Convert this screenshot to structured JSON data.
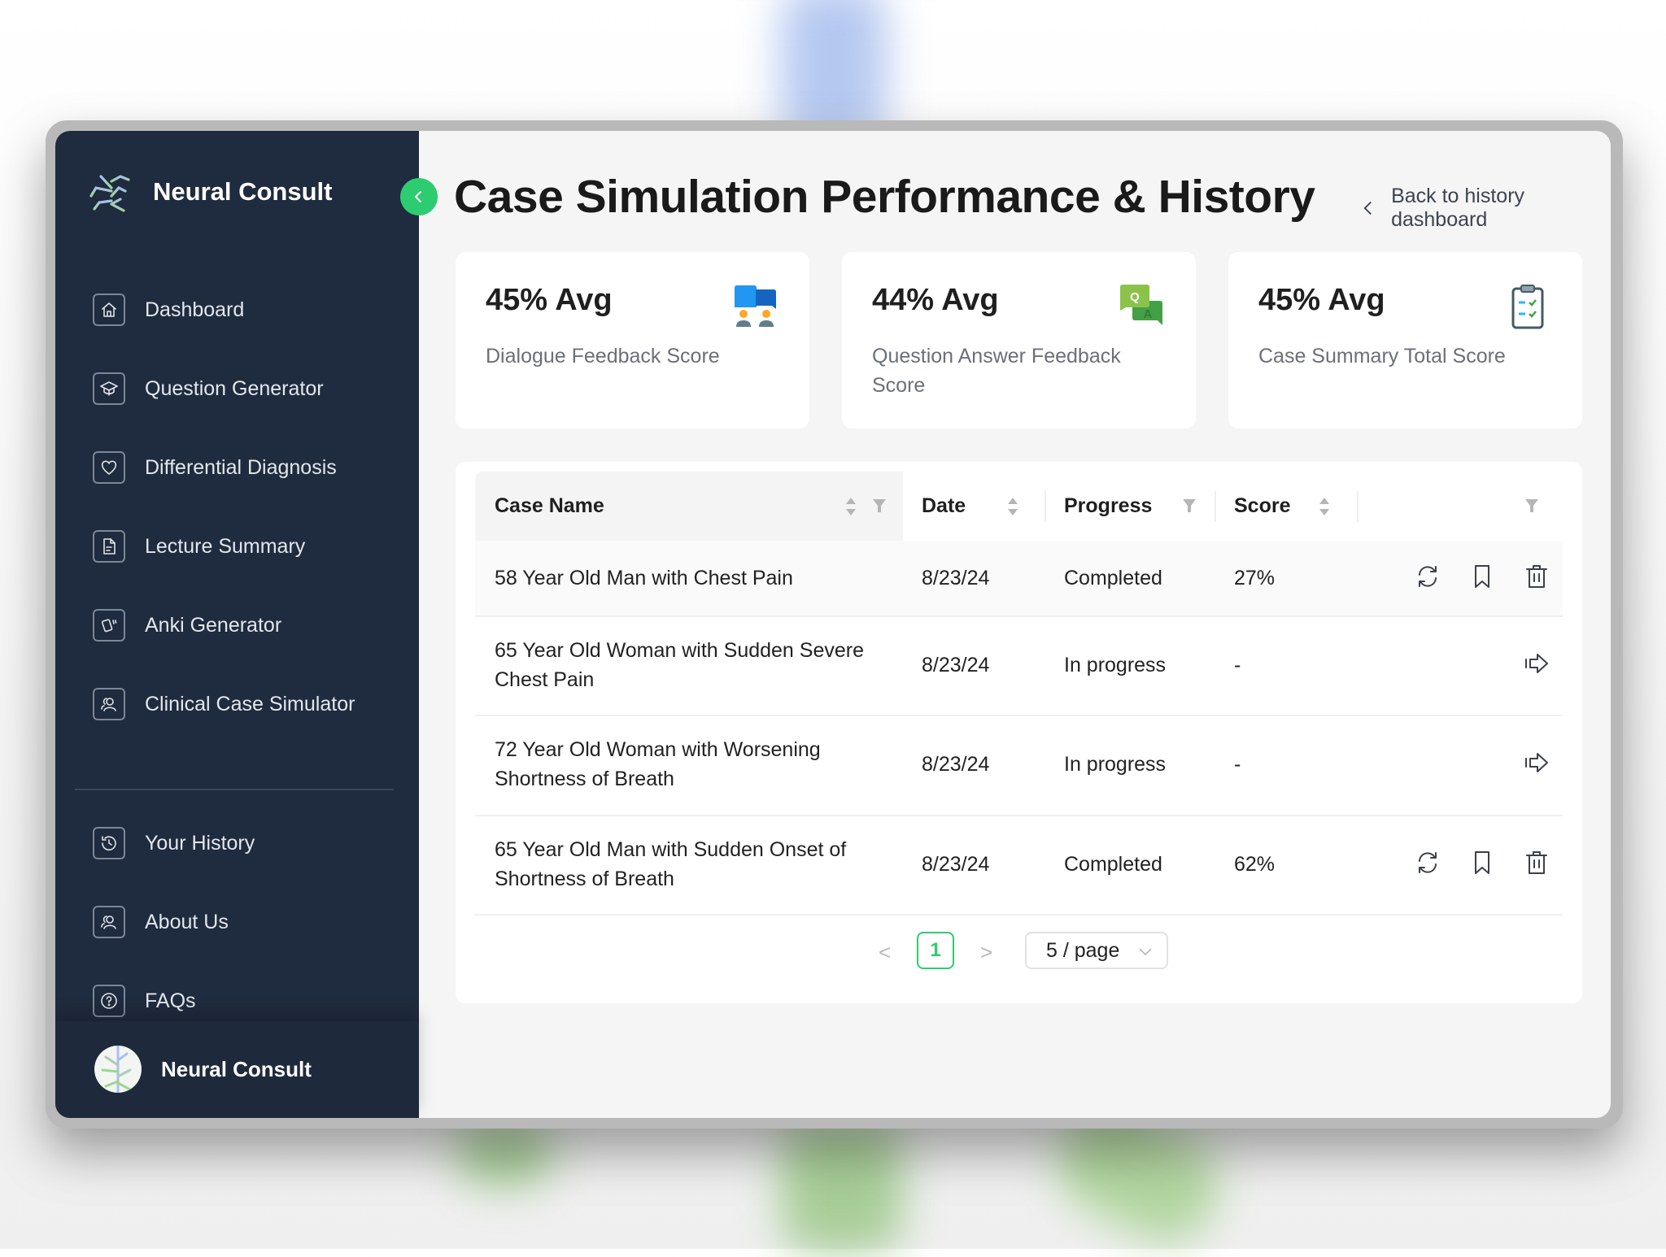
{
  "app": {
    "name": "Neural Consult"
  },
  "sidebar": {
    "brand": "Neural Consult",
    "items": [
      {
        "label": "Dashboard",
        "icon": "home-icon"
      },
      {
        "label": "Question Generator",
        "icon": "graduation-cap-icon"
      },
      {
        "label": "Differential Diagnosis",
        "icon": "heart-icon"
      },
      {
        "label": "Lecture Summary",
        "icon": "document-icon"
      },
      {
        "label": "Anki Generator",
        "icon": "cards-icon"
      },
      {
        "label": "Clinical Case Simulator",
        "icon": "users-icon"
      }
    ],
    "secondary_items": [
      {
        "label": "Your History",
        "icon": "history-icon"
      },
      {
        "label": "About Us",
        "icon": "users-icon"
      },
      {
        "label": "FAQs",
        "icon": "question-circle-icon"
      }
    ],
    "profile_name": "Neural Consult"
  },
  "header": {
    "title": "Case Simulation Performance & History",
    "back_link": "Back to history dashboard"
  },
  "stats": [
    {
      "value": "45% Avg",
      "label": "Dialogue Feedback Score",
      "icon": "dialogue-icon"
    },
    {
      "value": "44% Avg",
      "label": "Question Answer Feedback Score",
      "icon": "qa-icon",
      "icon_q": "Q",
      "icon_a": "A"
    },
    {
      "value": "45% Avg",
      "label": "Case Summary Total Score",
      "icon": "clipboard-icon"
    }
  ],
  "table": {
    "columns": [
      "Case Name",
      "Date",
      "Progress",
      "Score",
      ""
    ],
    "rows": [
      {
        "name": "58 Year Old Man with Chest Pain",
        "date": "8/23/24",
        "progress": "Completed",
        "score": "27%",
        "actions": [
          "retry",
          "bookmark",
          "delete"
        ]
      },
      {
        "name": "65 Year Old Woman with Sudden Severe Chest Pain",
        "date": "8/23/24",
        "progress": "In progress",
        "score": "-",
        "actions": [
          "continue"
        ]
      },
      {
        "name": "72 Year Old Woman with Worsening Shortness of Breath",
        "date": "8/23/24",
        "progress": "In progress",
        "score": "-",
        "actions": [
          "continue"
        ]
      },
      {
        "name": "65 Year Old Man with Sudden Onset of Shortness of Breath",
        "date": "8/23/24",
        "progress": "Completed",
        "score": "62%",
        "actions": [
          "retry",
          "bookmark",
          "delete"
        ]
      }
    ]
  },
  "pagination": {
    "prev": "<",
    "current_page": "1",
    "next": ">",
    "page_size": "5 / page"
  },
  "colors": {
    "accent": "#2ecc71",
    "sidebar_bg": "#1f2b3e",
    "page_bg": "#f5f5f5"
  }
}
